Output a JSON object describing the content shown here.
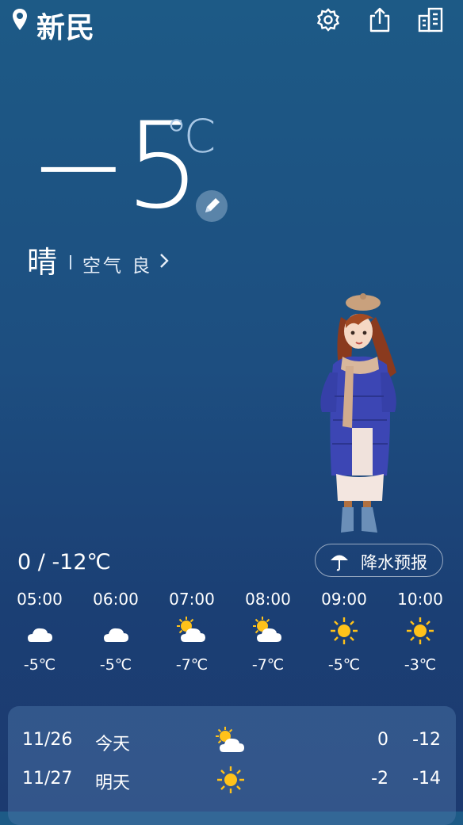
{
  "header": {
    "city": "新民",
    "icons": [
      "location-pin-icon",
      "settings-gear-icon",
      "share-icon",
      "city-manage-icon"
    ]
  },
  "current": {
    "temperature": "−5",
    "unit": "℃",
    "condition": "晴",
    "air_quality": "空气 良"
  },
  "range": "0 / -12℃",
  "precip_button": "降水预报",
  "hourly": [
    {
      "time": "05:00",
      "icon": "moon-cloud-icon",
      "temp": "-5℃"
    },
    {
      "time": "06:00",
      "icon": "moon-cloud-icon",
      "temp": "-5℃"
    },
    {
      "time": "07:00",
      "icon": "sun-cloud-icon",
      "temp": "-7℃"
    },
    {
      "time": "08:00",
      "icon": "sun-cloud-icon",
      "temp": "-7℃"
    },
    {
      "time": "09:00",
      "icon": "sun-icon",
      "temp": "-5℃"
    },
    {
      "time": "10:00",
      "icon": "sun-icon",
      "temp": "-3℃"
    }
  ],
  "daily": [
    {
      "date": "11/26",
      "weekday": "今天",
      "icon": "sun-cloud-icon",
      "high": "0",
      "low": "-12"
    },
    {
      "date": "11/27",
      "weekday": "明天",
      "icon": "sun-icon",
      "high": "-2",
      "low": "-14"
    }
  ],
  "colors": {
    "sun": "#ffc21a",
    "cloud": "#ffffff",
    "moon": "#ffcf2e",
    "accent_unit": "#a9c8e6"
  }
}
